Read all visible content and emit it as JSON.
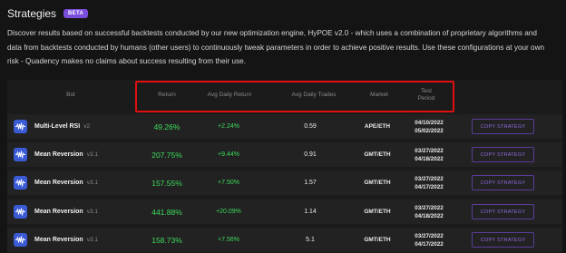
{
  "header": {
    "title": "Strategies",
    "badge": "BETA"
  },
  "description": {
    "line1": "Discover results based on successful backtests conducted by our new optimization engine, HyPOE v2.0 - which uses a combination of proprietary algorithms and",
    "line2": "data from backtests conducted by humans (other users) to continuously tweak parameters in order to achieve positive results. Use these configurations at your own",
    "line3": "risk - Quadency makes no claims about success resulting from their use."
  },
  "table": {
    "columns": {
      "bot": "Bot",
      "return": "Return",
      "avg_daily_return": "Avg Daily Return",
      "avg_daily_trades": "Avg Daily Trades",
      "market": "Market",
      "test_period": "Test Period"
    },
    "copy_label": "COPY STRATEGY",
    "rows": [
      {
        "name": "Multi-Level RSI",
        "version": "v2",
        "return": "49.26%",
        "avg_daily_return": "+2.24%",
        "avg_daily_trades": "0.59",
        "market": "APE/ETH",
        "start": "04/10/2022",
        "end": "05/02/2022"
      },
      {
        "name": "Mean Reversion",
        "version": "v3.1",
        "return": "207.75%",
        "avg_daily_return": "+9.44%",
        "avg_daily_trades": "0.91",
        "market": "GMT/ETH",
        "start": "03/27/2022",
        "end": "04/18/2022"
      },
      {
        "name": "Mean Reversion",
        "version": "v3.1",
        "return": "157.55%",
        "avg_daily_return": "+7.50%",
        "avg_daily_trades": "1.57",
        "market": "GMT/ETH",
        "start": "03/27/2022",
        "end": "04/17/2022"
      },
      {
        "name": "Mean Reversion",
        "version": "v3.1",
        "return": "441.88%",
        "avg_daily_return": "+20.09%",
        "avg_daily_trades": "1.14",
        "market": "GMT/ETH",
        "start": "03/27/2022",
        "end": "04/18/2022"
      },
      {
        "name": "Mean Reversion",
        "version": "v3.1",
        "return": "158.73%",
        "avg_daily_return": "+7.56%",
        "avg_daily_trades": "5.1",
        "market": "GMT/ETH",
        "start": "03/27/2022",
        "end": "04/17/2022"
      }
    ]
  },
  "icons": {
    "bot": "waveform-icon"
  },
  "colors": {
    "accent": "#7b4ddb",
    "positive": "#3ddc5c",
    "highlight": "#e01010",
    "bot_icon": "#3b5bd6"
  }
}
